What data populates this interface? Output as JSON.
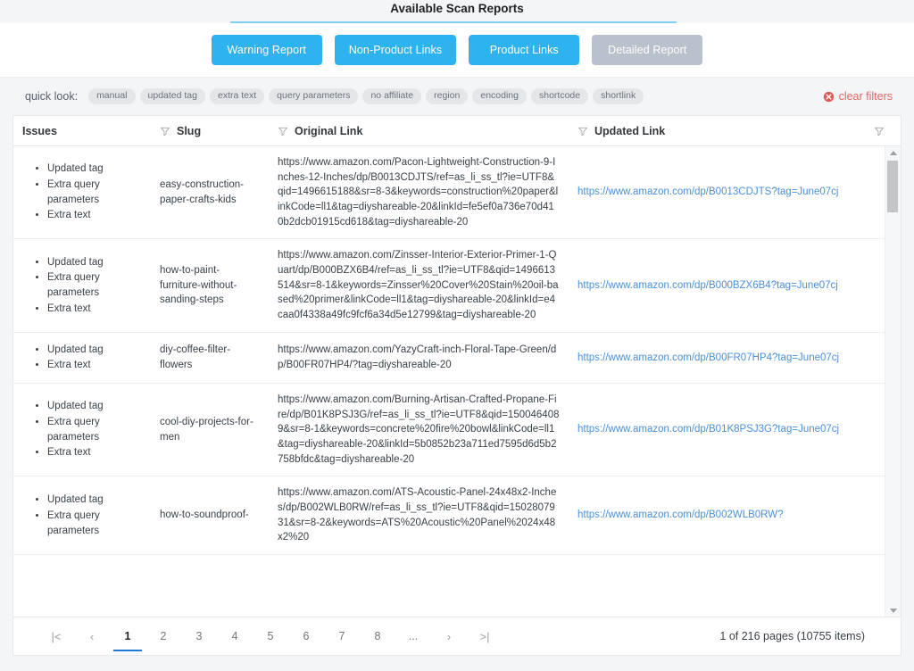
{
  "header": {
    "title": "Available Scan Reports",
    "underline_color": "#7fd0f2"
  },
  "reports": {
    "buttons": [
      {
        "label": "Warning Report",
        "state": "enabled"
      },
      {
        "label": "Non-Product Links",
        "state": "enabled"
      },
      {
        "label": "Product Links",
        "state": "enabled"
      },
      {
        "label": "Detailed Report",
        "state": "disabled"
      }
    ],
    "accent_color": "#2fb2f0",
    "disabled_color": "#b9c2cc"
  },
  "quick_look": {
    "label": "quick look:",
    "chips": [
      "manual",
      "updated tag",
      "extra text",
      "query parameters",
      "no affiliate",
      "region",
      "encoding",
      "shortcode",
      "shortlink"
    ],
    "clear_filters_label": "clear filters",
    "clear_filters_color": "#e06666"
  },
  "grid": {
    "columns": [
      {
        "label": "Issues",
        "filter": false
      },
      {
        "label": "Slug",
        "filter": true
      },
      {
        "label": "Original Link",
        "filter": true
      },
      {
        "label": "Updated Link",
        "filter": true
      },
      {
        "label": "",
        "filter": true
      }
    ],
    "rows": [
      {
        "issues": [
          "Updated tag",
          "Extra query parameters",
          "Extra text"
        ],
        "slug": "easy-construction-paper-crafts-kids",
        "original_link": "https://www.amazon.com/Pacon-Lightweight-Construction-9-Inches-12-Inches/dp/B0013CDJTS/ref=as_li_ss_tl?ie=UTF8&qid=1496615188&sr=8-3&keywords=construction%20paper&linkCode=ll1&tag=diyshareable-20&linkId=fe5ef0a736e70d410b2dcb01915cd618&tag=diyshareable-20",
        "updated_link": "https://www.amazon.com/dp/B0013CDJTS?tag=June07cj"
      },
      {
        "issues": [
          "Updated tag",
          "Extra query parameters",
          "Extra text"
        ],
        "slug": "how-to-paint-furniture-without-sanding-steps",
        "original_link": "https://www.amazon.com/Zinsser-Interior-Exterior-Primer-1-Quart/dp/B000BZX6B4/ref=as_li_ss_tl?ie=UTF8&qid=1496613514&sr=8-1&keywords=Zinsser%20Cover%20Stain%20oil-based%20primer&linkCode=ll1&tag=diyshareable-20&linkId=e4caa0f4338a49fc9fcf6a34d5e12799&tag=diyshareable-20",
        "updated_link": "https://www.amazon.com/dp/B000BZX6B4?tag=June07cj"
      },
      {
        "issues": [
          "Updated tag",
          "Extra text"
        ],
        "slug": "diy-coffee-filter-flowers",
        "original_link": "https://www.amazon.com/YazyCraft-inch-Floral-Tape-Green/dp/B00FR07HP4/?tag=diyshareable-20",
        "updated_link": "https://www.amazon.com/dp/B00FR07HP4?tag=June07cj"
      },
      {
        "issues": [
          "Updated tag",
          "Extra query parameters",
          "Extra text"
        ],
        "slug": "cool-diy-projects-for-men",
        "original_link": "https://www.amazon.com/Burning-Artisan-Crafted-Propane-Fire/dp/B01K8PSJ3G/ref=as_li_ss_tl?ie=UTF8&qid=1500464089&sr=8-1&keywords=concrete%20fire%20bowl&linkCode=ll1&tag=diyshareable-20&linkId=5b0852b23a711ed7595d6d5b2758bfdc&tag=diyshareable-20",
        "updated_link": "https://www.amazon.com/dp/B01K8PSJ3G?tag=June07cj"
      },
      {
        "issues": [
          "Updated tag",
          "Extra query parameters"
        ],
        "slug": "how-to-soundproof-",
        "original_link": "https://www.amazon.com/ATS-Acoustic-Panel-24x48x2-Inches/dp/B002WLB0RW/ref=as_li_ss_tl?ie=UTF8&qid=1502807931&sr=8-2&keywords=ATS%20Acoustic%20Panel%2024x48x2%20",
        "updated_link": "https://www.amazon.com/dp/B002WLB0RW?"
      }
    ]
  },
  "pager": {
    "first_label": "|<",
    "prev_label": "‹",
    "pages": [
      "1",
      "2",
      "3",
      "4",
      "5",
      "6",
      "7",
      "8"
    ],
    "ellipsis": "...",
    "next_label": "›",
    "last_label": ">|",
    "active_page": "1",
    "info": "1 of 216 pages (10755 items)"
  }
}
